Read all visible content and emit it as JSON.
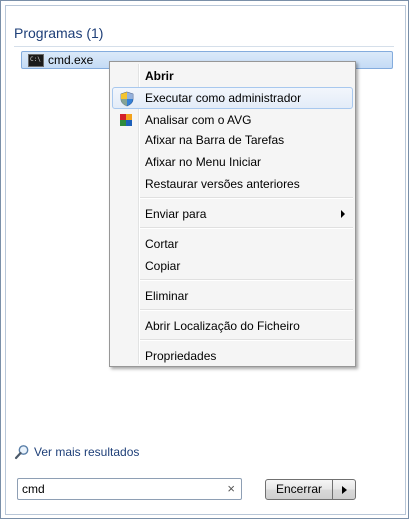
{
  "results": {
    "programs_header": "Programas (1)",
    "program_item": {
      "label": "cmd.exe",
      "icon": "cmd-console-icon"
    }
  },
  "context_menu": {
    "items": [
      {
        "label": "Abrir",
        "bold": true
      },
      {
        "label": "Executar como administrador",
        "icon": "uac-shield-icon",
        "highlighted": true
      },
      {
        "label": "Analisar com o AVG",
        "icon": "avg-icon"
      },
      {
        "label": "Afixar na Barra de Tarefas"
      },
      {
        "label": "Afixar no Menu Iniciar"
      },
      {
        "label": "Restaurar versões anteriores"
      },
      {
        "label": "Enviar para",
        "submenu": true
      },
      {
        "label": "Cortar"
      },
      {
        "label": "Copiar"
      },
      {
        "label": "Eliminar"
      },
      {
        "label": "Abrir Localização do Ficheiro"
      },
      {
        "label": "Propriedades"
      }
    ]
  },
  "footer": {
    "more_results": "Ver mais resultados",
    "search_value": "cmd",
    "clear_symbol": "×",
    "shutdown_label": "Encerrar"
  },
  "colors": {
    "header_text": "#1e3f78",
    "selection_bg": "#c4dbf5",
    "menu_bg": "#f5f5f5"
  }
}
